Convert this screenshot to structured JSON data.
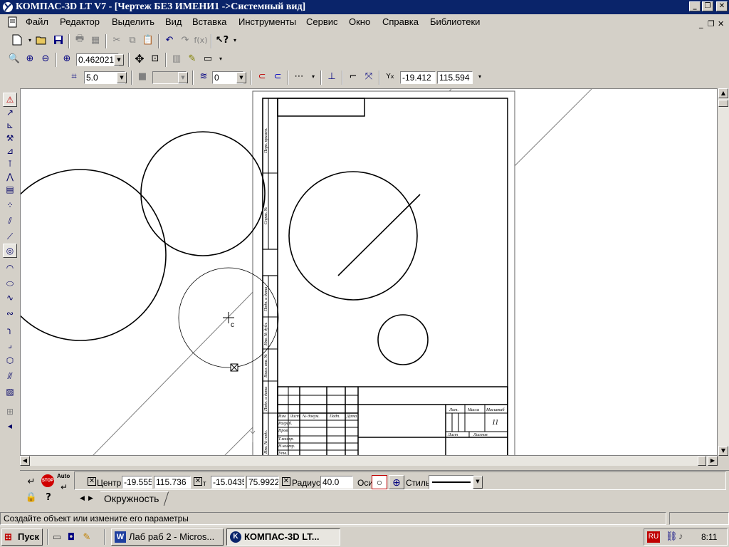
{
  "window": {
    "title": "КОМПАС-3D LT V7 - [Чертеж БЕЗ ИМЕНИ1 ->Системный вид]"
  },
  "menu": [
    "Файл",
    "Редактор",
    "Выделить",
    "Вид",
    "Вставка",
    "Инструменты",
    "Сервис",
    "Окно",
    "Справка",
    "Библиотеки"
  ],
  "view_toolbar": {
    "zoom": "0.462021"
  },
  "current_state": {
    "step": "5.0",
    "layer": "0",
    "cursor_x": "-19.412",
    "cursor_y": "115.594"
  },
  "properties": {
    "center_label": "Центр",
    "center_x": "-19.5555",
    "center_y": "115.736",
    "point_label": "т",
    "point_x": "-15.0435",
    "point_y": "75.9922",
    "radius_label": "Радиус",
    "radius": "40.0",
    "axes_label": "Оси",
    "style_label": "Стиль",
    "auto_label": "Auto",
    "stop_label": "STOP",
    "tab": "Окружность"
  },
  "drawing": {
    "cursor_label": "c",
    "sheet_number": "11",
    "title_block": {
      "lit": "Лит.",
      "mass": "Масса",
      "scale": "Масштаб",
      "sheet": "Лист",
      "sheets": "Листов",
      "change": "Изм",
      "list": "Лист",
      "doc_no": "№ докум.",
      "sign": "Подп.",
      "date": "Дата",
      "developed": "Разраб.",
      "checked": "Пров.",
      "tcontrol": "Т.контр.",
      "ncontrol": "Н.контр.",
      "approved": "Утв."
    },
    "side_labels": [
      "Перв. примен.",
      "Справ. №",
      "Подп. и дата",
      "Инв. № дубл.",
      "Взам. инв. №",
      "Подп. и дата",
      "Инв. № подл."
    ]
  },
  "status": {
    "message": "Создайте объект или измените его параметры"
  },
  "taskbar": {
    "start": "Пуск",
    "tasks": [
      "Лаб раб 2 - Micros...",
      "КОМПАС-3D LT..."
    ],
    "lang": "RU",
    "clock": "8:11"
  },
  "colors": {
    "titlebar": "#0a246a",
    "face": "#d4d0c8",
    "canvas": "#ffffff"
  }
}
